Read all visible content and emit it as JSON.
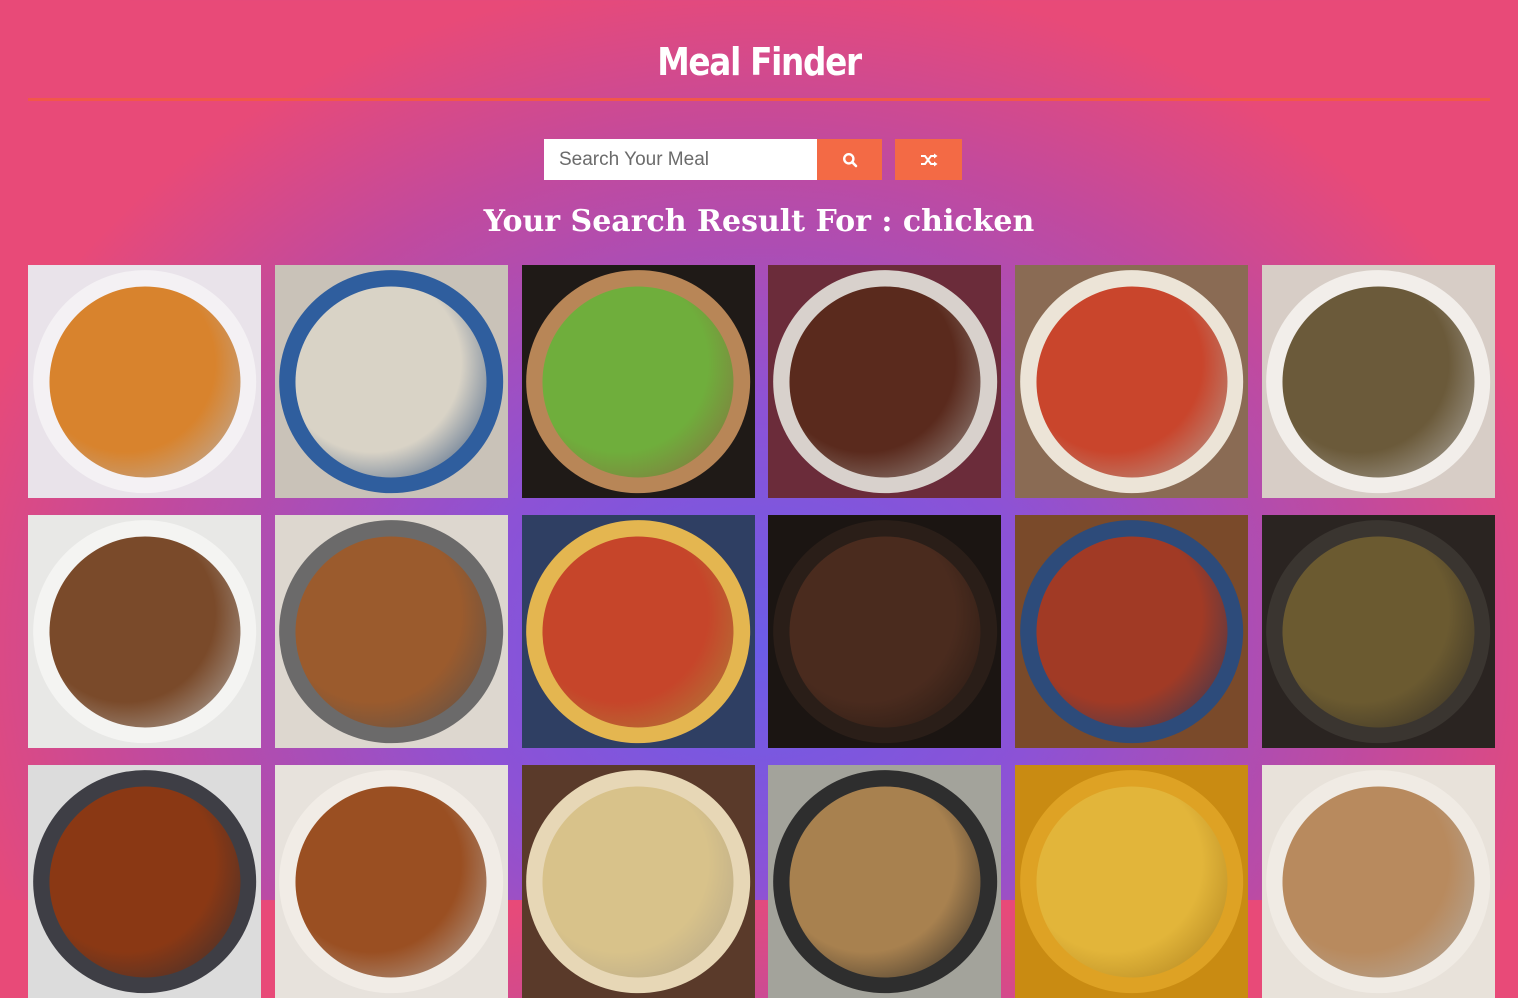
{
  "app": {
    "title": "Meal Finder"
  },
  "search": {
    "placeholder": "Search Your Meal",
    "value": "",
    "search_icon": "search-icon",
    "random_icon": "shuffle-icon"
  },
  "results": {
    "heading": "Your Search Result For : chicken",
    "meals": [
      {
        "bg": "#e9e3ea",
        "rim": "#f4f1f4",
        "dish": "#d8832d"
      },
      {
        "bg": "#c9c2b8",
        "rim": "#2f5e9e",
        "dish": "#d9d3c6"
      },
      {
        "bg": "#1f1a17",
        "rim": "#b88657",
        "dish": "#6fae3c"
      },
      {
        "bg": "#6b2c3a",
        "rim": "#d8d1cc",
        "dish": "#5a2a1d"
      },
      {
        "bg": "#8a6b54",
        "rim": "#ece4d7",
        "dish": "#c9452c"
      },
      {
        "bg": "#d7cdc6",
        "rim": "#f2eeea",
        "dish": "#6b5a3a"
      },
      {
        "bg": "#e8e8e6",
        "rim": "#f4f4f2",
        "dish": "#7a4a2a"
      },
      {
        "bg": "#ddd7cf",
        "rim": "#6b6a6a",
        "dish": "#9b5b2d"
      },
      {
        "bg": "#2f3f63",
        "rim": "#e4b650",
        "dish": "#c6452a"
      },
      {
        "bg": "#1b1512",
        "rim": "#2a1e18",
        "dish": "#4a2b1e"
      },
      {
        "bg": "#7a4a2a",
        "rim": "#2d4b7a",
        "dish": "#a13a25"
      },
      {
        "bg": "#2a2421",
        "rim": "#3a3530",
        "dish": "#6b5a30"
      },
      {
        "bg": "#dcdcdc",
        "rim": "#3e3e45",
        "dish": "#8a3814"
      },
      {
        "bg": "#e7e2dc",
        "rim": "#f1ece6",
        "dish": "#9a4f22"
      },
      {
        "bg": "#5a3a2a",
        "rim": "#e7d7b6",
        "dish": "#d8c28a"
      },
      {
        "bg": "#a3a39b",
        "rim": "#2e2e2e",
        "dish": "#a8814f"
      },
      {
        "bg": "#c98b12",
        "rim": "#dea224",
        "dish": "#e2b53a"
      },
      {
        "bg": "#e8e2da",
        "rim": "#f0ebe4",
        "dish": "#b88a5e"
      }
    ]
  },
  "colors": {
    "accent": "#f36a45",
    "header_rule": "#f2574a"
  }
}
